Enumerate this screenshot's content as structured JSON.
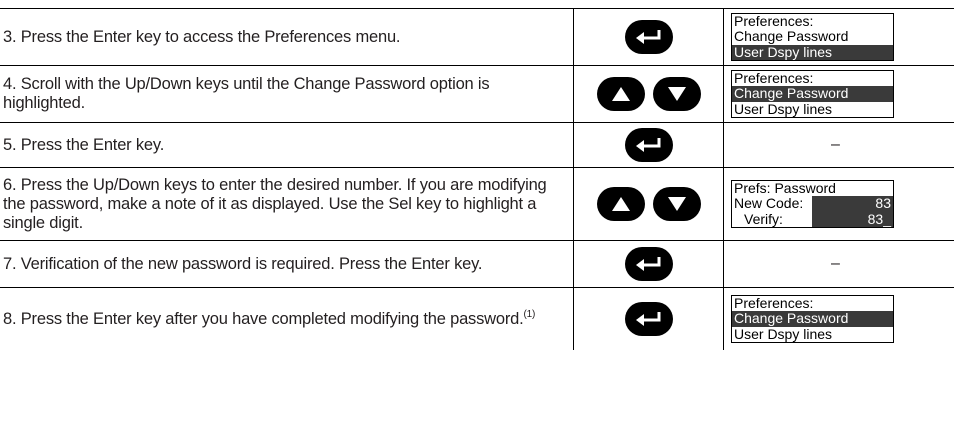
{
  "steps": [
    {
      "text": "3. Press the Enter key to access the Preferences menu.",
      "keys": [
        "enter-key"
      ],
      "display": {
        "lines": [
          "Preferences:",
          "Change Password",
          "User Dspy lines"
        ],
        "highlighted": 2
      }
    },
    {
      "text": "4. Scroll with the Up/Down keys until the Change Password option is highlighted.",
      "keys": [
        "up-arrow-key",
        "down-arrow-key"
      ],
      "display": {
        "lines": [
          "Preferences:",
          "Change Password",
          "User Dspy lines"
        ],
        "highlighted": 1
      }
    },
    {
      "text": "5. Press the Enter key.",
      "keys": [
        "enter-key"
      ],
      "display_text": "–"
    },
    {
      "text": "6. Press the Up/Down keys to enter the desired number. If you are modifying the password, make a note of it as displayed. Use the Sel key to highlight a single digit.",
      "keys": [
        "up-arrow-key",
        "down-arrow-key"
      ],
      "display": {
        "title": "Prefs: Password",
        "new_code_label": "New Code:",
        "new_code_value": "83",
        "verify_label": "Verify:",
        "verify_value": "83_"
      }
    },
    {
      "text": "7. Verification of the new password is required. Press the Enter key.",
      "keys": [
        "enter-key"
      ],
      "display_text": "–"
    },
    {
      "text": "8. Press the Enter key after you have completed modifying the password.",
      "footnote": "(1)",
      "keys": [
        "enter-key"
      ],
      "display": {
        "lines": [
          "Preferences:",
          "Change Password",
          "User Dspy lines"
        ],
        "highlighted": 1
      }
    }
  ]
}
